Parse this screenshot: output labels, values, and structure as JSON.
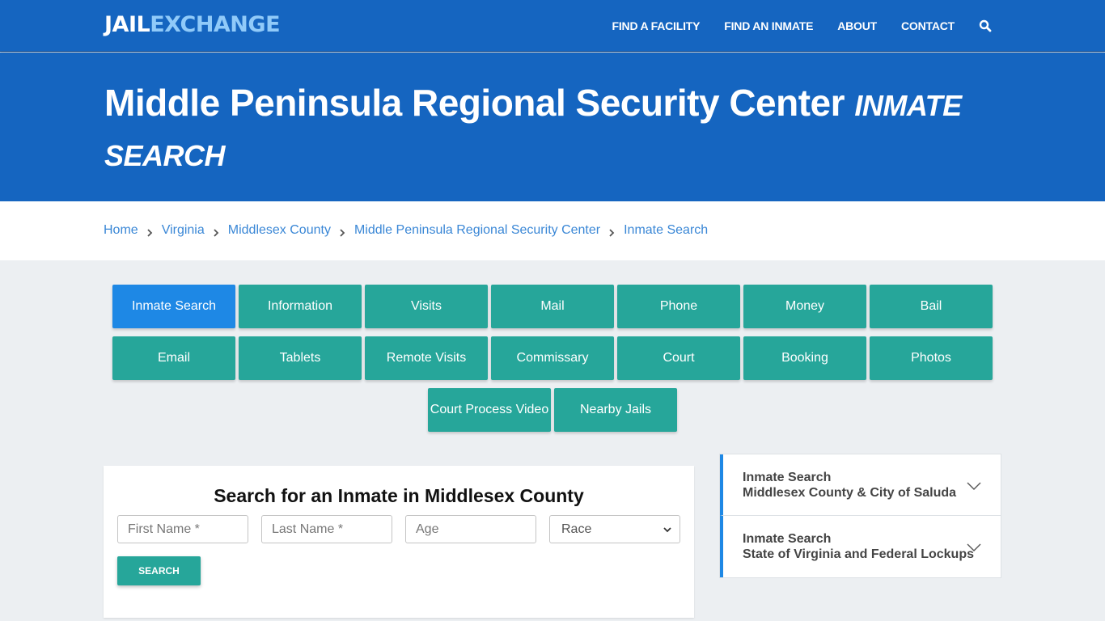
{
  "navbar": {
    "logo_part1": "JAIL",
    "logo_part2": "EXCHANGE",
    "links": [
      "FIND A FACILITY",
      "FIND AN INMATE",
      "ABOUT",
      "CONTACT"
    ],
    "search_icon": "search-icon"
  },
  "hero": {
    "title": "Middle Peninsula Regional Security Center",
    "subtitle": "Inmate Search"
  },
  "breadcrumb": [
    "Home",
    "Virginia",
    "Middlesex County",
    "Middle Peninsula Regional Security Center",
    "Inmate Search"
  ],
  "tabs": [
    {
      "label": "Inmate Search",
      "active": true
    },
    {
      "label": "Information"
    },
    {
      "label": "Visits"
    },
    {
      "label": "Mail"
    },
    {
      "label": "Phone"
    },
    {
      "label": "Money"
    },
    {
      "label": "Bail"
    },
    {
      "label": "Email"
    },
    {
      "label": "Tablets"
    },
    {
      "label": "Remote Visits"
    },
    {
      "label": "Commissary"
    },
    {
      "label": "Court"
    },
    {
      "label": "Booking"
    },
    {
      "label": "Photos"
    },
    {
      "label": "Court Process Video"
    },
    {
      "label": "Nearby Jails"
    }
  ],
  "search_form": {
    "title": "Search for an Inmate in Middlesex County",
    "first_name_placeholder": "First Name *",
    "last_name_placeholder": "Last Name *",
    "age_placeholder": "Age",
    "race_selected": "Race",
    "button_label": "SEARCH"
  },
  "accordion": [
    {
      "line1": "Inmate Search",
      "line2": "Middlesex County & City of Saluda"
    },
    {
      "line1": "Inmate Search",
      "line2": "State of Virginia and Federal Lockups"
    }
  ],
  "colors": {
    "brand_blue": "#1565c0",
    "accent_teal": "#26a69a",
    "active_blue": "#1e88e5",
    "link_blue": "#3a87d6"
  }
}
